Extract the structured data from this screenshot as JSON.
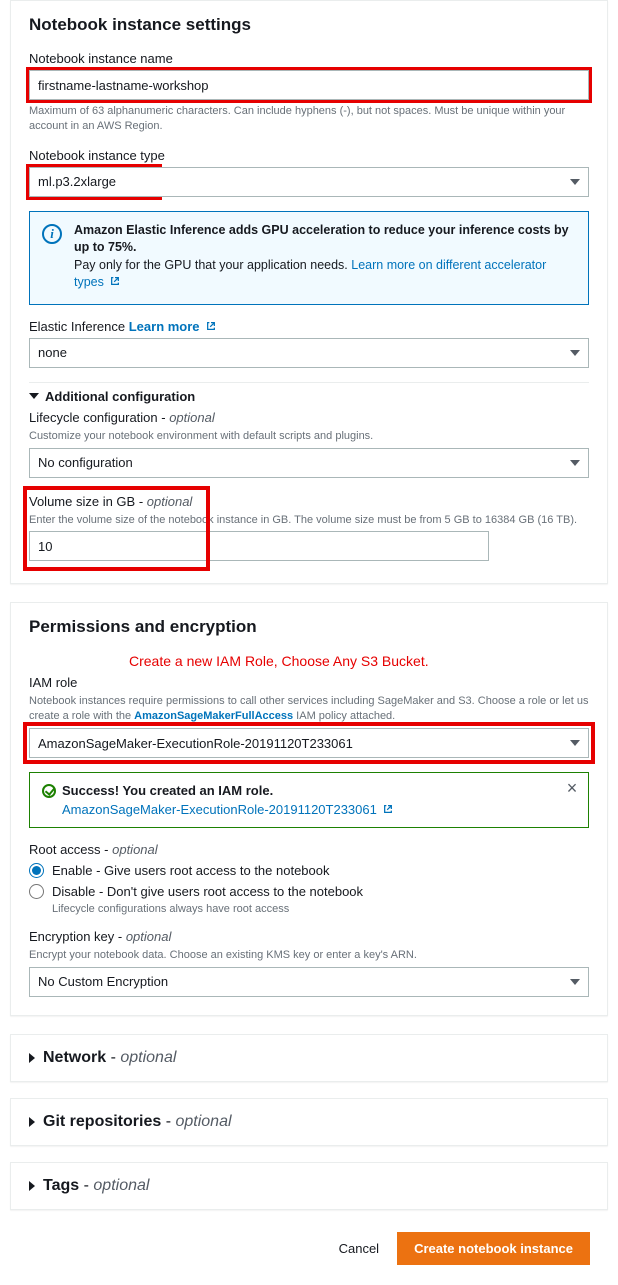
{
  "settings": {
    "title": "Notebook instance settings",
    "name_label": "Notebook instance name",
    "name_value": "firstname-lastname-workshop",
    "name_hint": "Maximum of 63 alphanumeric characters. Can include hyphens (-), but not spaces. Must be unique within your account in an AWS Region.",
    "type_label": "Notebook instance type",
    "type_value": "ml.p3.2xlarge",
    "info_bold": "Amazon Elastic Inference adds GPU acceleration to reduce your inference costs by up to 75%.",
    "info_text": "Pay only for the GPU that your application needs.  ",
    "info_link": "Learn more on different accelerator types",
    "ei_label": "Elastic Inference",
    "ei_learn": "Learn more",
    "ei_value": "none",
    "addl_config": "Additional configuration",
    "lifecycle_label": "Lifecycle configuration",
    "lifecycle_hint": "Customize your notebook environment with default scripts and plugins.",
    "lifecycle_value": "No configuration",
    "volume_label": "Volume size in GB",
    "volume_hint": "Enter the volume size of the notebook instance in GB. The volume size must be from 5 GB to 16384 GB (16 TB).",
    "volume_value": "10"
  },
  "perm": {
    "title": "Permissions and encryption",
    "annotation": "Create a new IAM Role, Choose Any S3 Bucket.",
    "iam_label": "IAM role",
    "iam_hint_pre": "Notebook instances require permissions to call other services including SageMaker and S3. Choose a role or let us create a role with the ",
    "iam_hint_link": "AmazonSageMakerFullAccess",
    "iam_hint_post": " IAM policy attached.",
    "iam_value": "AmazonSageMaker-ExecutionRole-20191120T233061",
    "success_title": "Success! You created an IAM role.",
    "success_link": "AmazonSageMaker-ExecutionRole-20191120T233061",
    "root_label": "Root access",
    "root_enable": "Enable - Give users root access to the notebook",
    "root_disable": "Disable - Don't give users root access to the notebook",
    "root_sub": "Lifecycle configurations always have root access",
    "enc_label": "Encryption key",
    "enc_hint": "Encrypt your notebook data. Choose an existing KMS key or enter a key's ARN.",
    "enc_value": "No Custom Encryption"
  },
  "collapse": {
    "network": "Network",
    "git": "Git repositories",
    "tags": "Tags"
  },
  "footer": {
    "cancel": "Cancel",
    "create": "Create notebook instance"
  },
  "optional": "optional"
}
